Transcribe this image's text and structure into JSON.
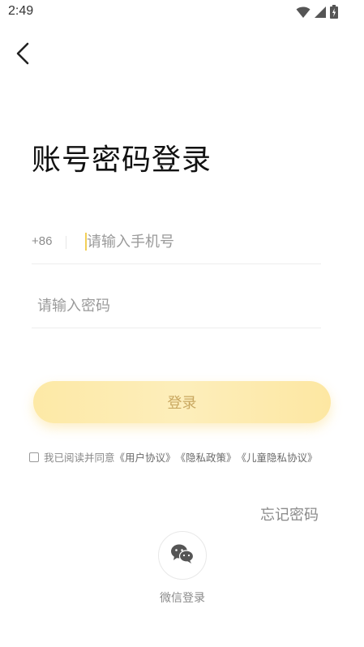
{
  "status_bar": {
    "time": "2:49",
    "icons": [
      "wifi-icon",
      "signal-icon",
      "battery-icon"
    ]
  },
  "header": {
    "back_icon": "back-arrow-icon"
  },
  "title": "账号密码登录",
  "phone": {
    "country_code": "+86",
    "placeholder": "请输入手机号",
    "value": ""
  },
  "password": {
    "placeholder": "请输入密码",
    "value": ""
  },
  "login_button": {
    "label": "登录"
  },
  "agreement": {
    "checked": false,
    "prefix": "我已阅读并同意",
    "user_agreement": "《用户协议》",
    "privacy_policy": "《隐私政策》",
    "child_privacy": "《儿童隐私协议》"
  },
  "forgot_password": "忘记密码",
  "wechat_login": {
    "label": "微信登录",
    "icon": "wechat-icon"
  },
  "colors": {
    "accent": "#fde9a6",
    "accent_text": "#c9a861",
    "cursor": "#f2cf57"
  }
}
